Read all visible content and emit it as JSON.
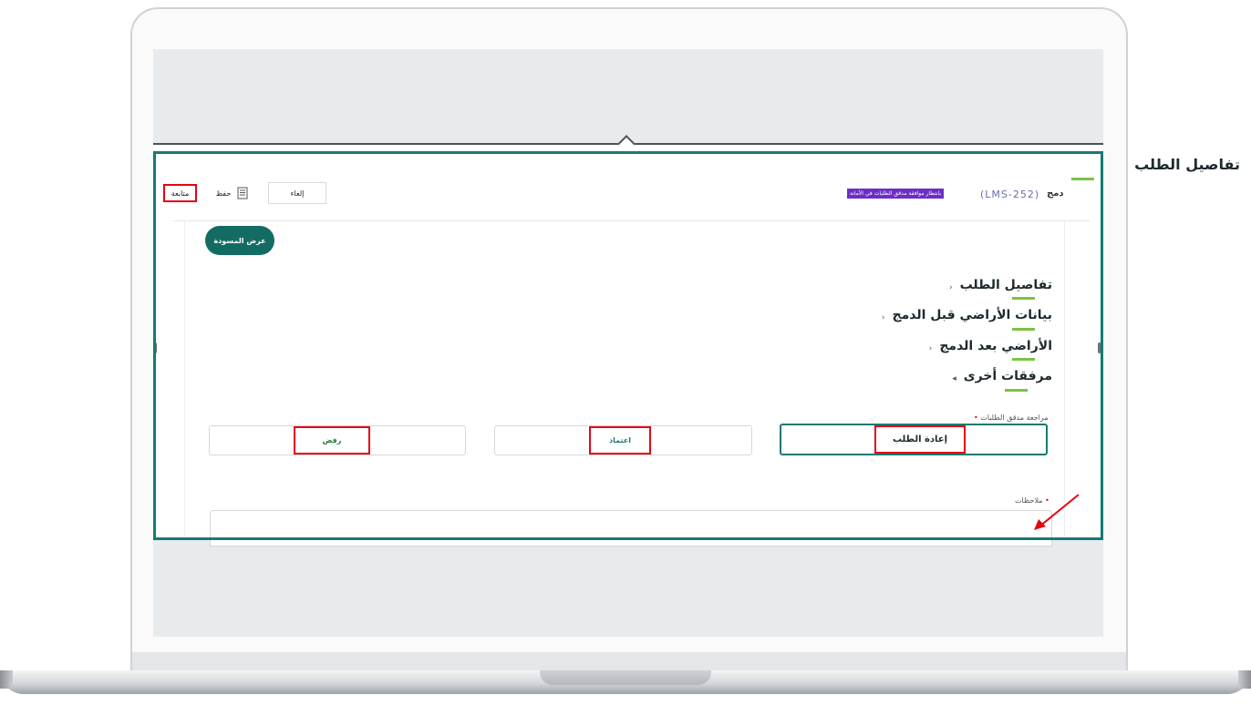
{
  "header": {
    "page_title": "تفاصيل الطلب",
    "request_type": "دمج",
    "request_code": "(LMS-252)",
    "status_badge": "بانتظار موافقة مدقق الطلبات في الأمانة"
  },
  "toolbar": {
    "follow_label": "متابعة",
    "save_label": "حفظ",
    "cancel_label": "إلغاء",
    "draft_label": "عرض المسودة"
  },
  "sections": [
    {
      "label": "تفاصيل الطلب",
      "icon": "chevron-left-icon"
    },
    {
      "label": "بيانات الأراضي قبل الدمج",
      "icon": "chevron-left-icon"
    },
    {
      "label": "الأراضي بعد الدمج",
      "icon": "chevron-left-icon"
    },
    {
      "label": "مرفقات أخرى",
      "icon": "caret-left-icon"
    }
  ],
  "review": {
    "label": "مراجعة مدقق الطلبات",
    "required_mark": "•",
    "options": [
      {
        "label": "إعادة الطلب",
        "selected": true
      },
      {
        "label": "اعتماد",
        "selected": false
      },
      {
        "label": "رفض",
        "selected": false
      }
    ]
  },
  "notes": {
    "label": "ملاحظات",
    "required_mark": "•"
  },
  "colors": {
    "frame": "#177a73",
    "highlight": "#e30613",
    "accent_green": "#7cc243",
    "badge_purple": "#6c2ec4",
    "approve_text": "#177a73",
    "reject_text": "#1e7a3a"
  }
}
